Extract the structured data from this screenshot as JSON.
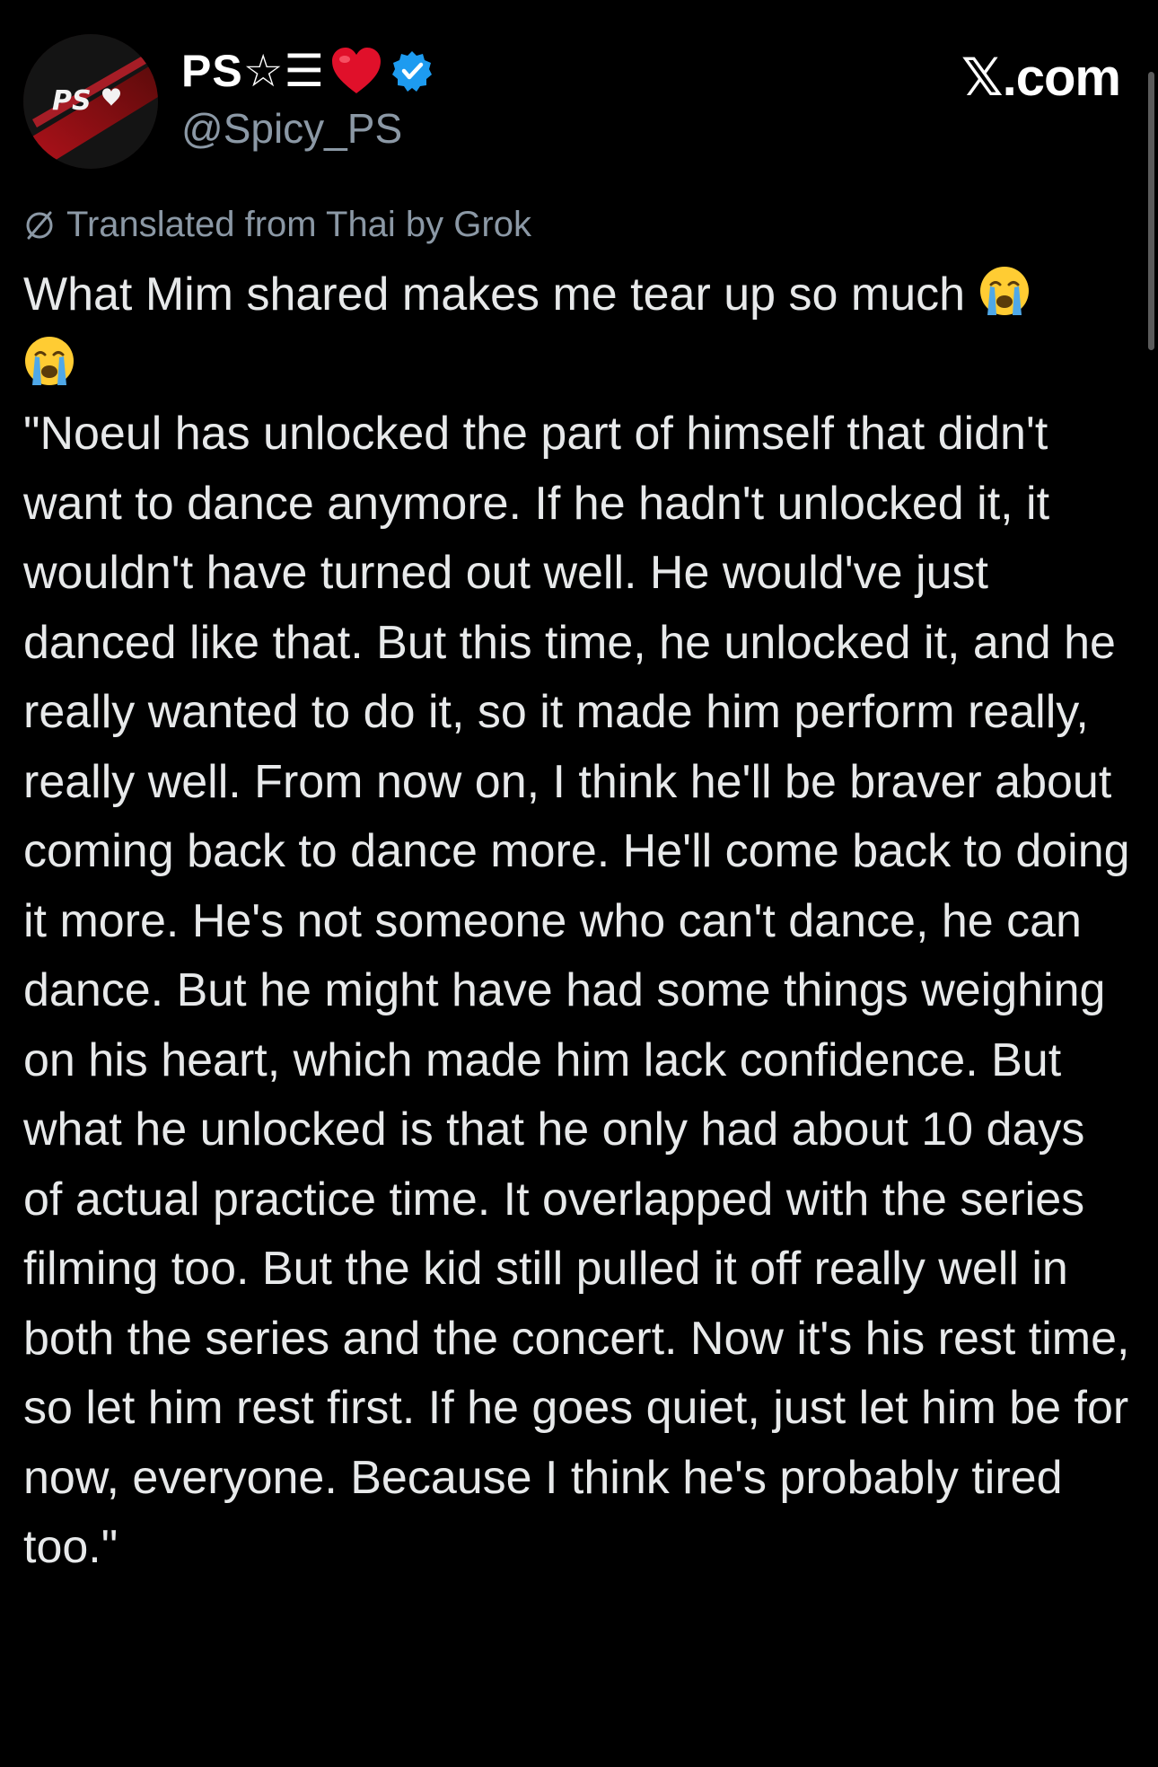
{
  "author": {
    "display_name": "PS☆☰",
    "handle": "@Spicy_PS",
    "avatar_text": "PS"
  },
  "site": {
    "label": "𝕏.com"
  },
  "translation": {
    "note": "Translated from Thai by Grok"
  },
  "post": {
    "first_line": "What Mim shared makes me tear up so much ",
    "body": "\"Noeul has unlocked the part of himself that didn't want to dance anymore. If he hadn't unlocked it, it wouldn't have turned out well. He would've just danced like that. But this time, he unlocked it, and he really wanted to do it, so it made him perform really, really well. From now on, I think he'll be braver about coming back to dance more. He'll come back to doing it more. He's not someone who can't dance, he can dance. But he might have had some things weighing on his heart, which made him lack confidence. But what he unlocked is that he only had about 10 days of actual practice time. It overlapped with the series filming too. But the kid still pulled it off really well in both the series and the concert. Now it's his rest time, so let him rest first. If he goes quiet, just let him be for now, everyone. Because I think he's probably tired too.\""
  },
  "colors": {
    "background": "#000000",
    "text": "#e7e9ea",
    "muted": "#8b98a5",
    "verified": "#1d9bf0",
    "heart": "#e0102a"
  }
}
